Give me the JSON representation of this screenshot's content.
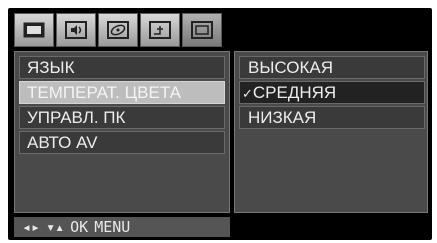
{
  "tabs": [
    {
      "icon": "monitor-icon"
    },
    {
      "icon": "speaker-icon"
    },
    {
      "icon": "disc-icon"
    },
    {
      "icon": "graph-icon"
    },
    {
      "icon": "screen-icon"
    }
  ],
  "menu": {
    "items": [
      {
        "label": "ЯЗЫК"
      },
      {
        "label": "ТЕМПЕРАТ. ЦВЕТА"
      },
      {
        "label": "УПРАВЛ. ПК"
      },
      {
        "label": "АВТО AV"
      }
    ],
    "selected_index": 1
  },
  "submenu": {
    "items": [
      {
        "label": "ВЫСОКАЯ"
      },
      {
        "label": "СРЕДНЯЯ"
      },
      {
        "label": "НИЗКАЯ"
      }
    ],
    "checked_index": 1,
    "check_mark": "✓"
  },
  "help": {
    "nav_lr": "◂▸",
    "nav_ud": "▾▴",
    "ok": "OK",
    "menu": "MENU"
  },
  "colors": {
    "background": "#000000",
    "panel": "#4a4a4a",
    "item": "#3a3a3a",
    "selected": "#bdbdbd"
  }
}
